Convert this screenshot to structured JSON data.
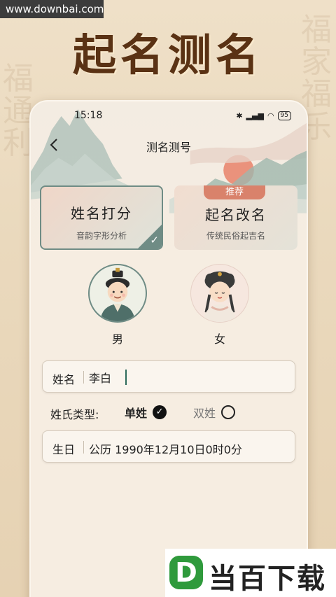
{
  "watermark": "www.downbai.com",
  "promo_title": "起名测名",
  "status_bar": {
    "time": "15:18",
    "battery": "95"
  },
  "nav": {
    "title": "测名测号"
  },
  "tabs": [
    {
      "title": "姓名打分",
      "subtitle": "音韵字形分析",
      "selected": true
    },
    {
      "title": "起名改名",
      "subtitle": "传统民俗起吉名",
      "badge": "推荐",
      "selected": false
    }
  ],
  "gender": {
    "male_label": "男",
    "female_label": "女",
    "selected": "男"
  },
  "name_field": {
    "label": "姓名",
    "value": "李白"
  },
  "surname_type": {
    "label": "姓氏类型:",
    "single": "单姓",
    "double": "双姓",
    "selected": "单姓"
  },
  "birthday_field": {
    "label": "生日",
    "value": "公历 1990年12月10日0时0分"
  },
  "bottom_logo": {
    "mark": "D",
    "text": "当百下载"
  },
  "colors": {
    "accent": "#6f8c85",
    "title_brown": "#5a3214",
    "badge": "#d9826b"
  }
}
